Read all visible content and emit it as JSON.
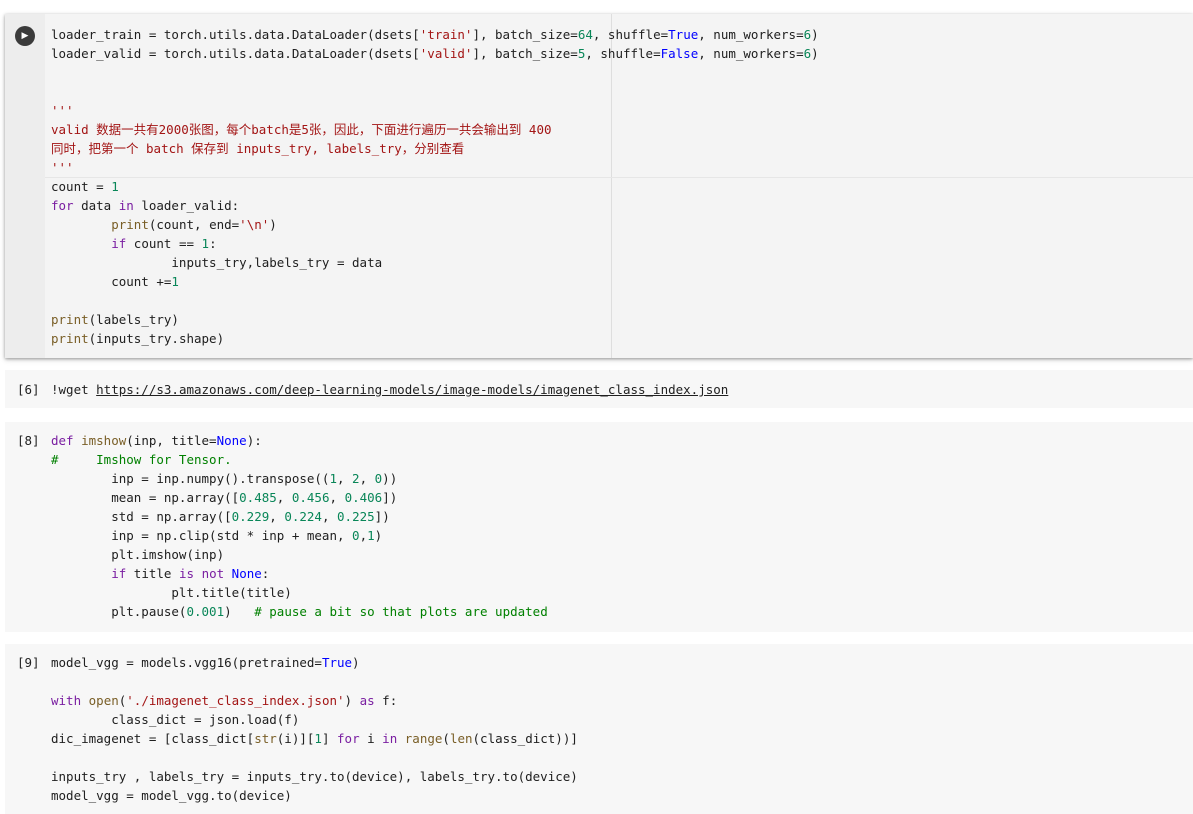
{
  "cells": [
    {
      "id": "cell-active",
      "exec_count": "",
      "lines": [
        "loader_train = torch.utils.data.DataLoader(dsets['train'], batch_size=64, shuffle=True, num_workers=6)",
        "loader_valid = torch.utils.data.DataLoader(dsets['valid'], batch_size=5, shuffle=False, num_workers=6)",
        "",
        "",
        "'''",
        "valid 数据一共有2000张图，每个batch是5张，因此，下面进行遍历一共会输出到 400",
        "同时，把第一个 batch 保存到 inputs_try, labels_try，分别查看",
        "'''",
        "count = 1",
        "for data in loader_valid:",
        "        print(count, end='\\n')",
        "        if count == 1:",
        "                inputs_try,labels_try = data",
        "        count +=1",
        "",
        "print(labels_try)",
        "print(inputs_try.shape)"
      ]
    },
    {
      "id": "cell-6",
      "exec_count": "[6]",
      "lines": [
        "!wget https://s3.amazonaws.com/deep-learning-models/image-models/imagenet_class_index.json"
      ]
    },
    {
      "id": "cell-8",
      "exec_count": "[8]",
      "lines": [
        "def imshow(inp, title=None):",
        "#     Imshow for Tensor.",
        "        inp = inp.numpy().transpose((1, 2, 0))",
        "        mean = np.array([0.485, 0.456, 0.406])",
        "        std = np.array([0.229, 0.224, 0.225])",
        "        inp = np.clip(std * inp + mean, 0,1)",
        "        plt.imshow(inp)",
        "        if title is not None:",
        "                plt.title(title)",
        "        plt.pause(0.001)   # pause a bit so that plots are updated"
      ]
    },
    {
      "id": "cell-9",
      "exec_count": "[9]",
      "lines": [
        "model_vgg = models.vgg16(pretrained=True)",
        "",
        "with open('./imagenet_class_index.json') as f:",
        "        class_dict = json.load(f)",
        "dic_imagenet = [class_dict[str(i)][1] for i in range(len(class_dict))]",
        "",
        "inputs_try , labels_try = inputs_try.to(device), labels_try.to(device)",
        "model_vgg = model_vgg.to(device)"
      ]
    }
  ],
  "run_button_icon": "play-icon",
  "colors": {
    "keyword": "#7a1ea1",
    "string": "#a31515",
    "number": "#098658",
    "comment": "#008000",
    "constant": "#0000ff"
  }
}
